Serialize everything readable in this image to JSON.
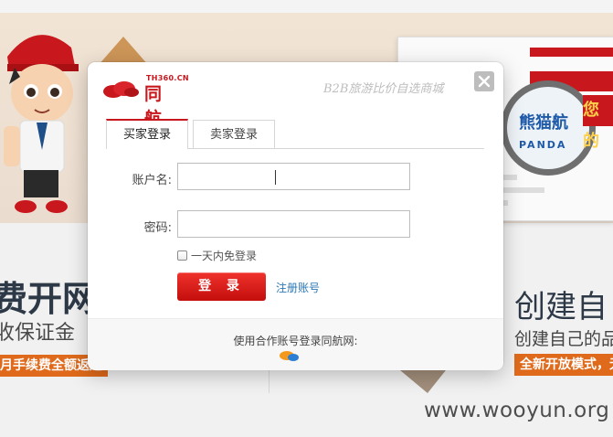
{
  "background": {
    "promo_left_title": "费开网",
    "promo_left_subtitle": "收保证金",
    "promo_left_bar": "月手续费全额返还",
    "promo_right_title": "创建自",
    "promo_right_subtitle": "创建自己的品",
    "promo_right_bar": "全新开放模式，无",
    "magnifier_brand": "熊猫航",
    "magnifier_brand_sub": "PANDA",
    "magnifier_red": "您的",
    "watermark": "www.wooyun.org"
  },
  "dialog": {
    "logo_domain": "TH360.CN",
    "logo_name": "同航",
    "slogan": "B2B旅游比价自选商城",
    "close_icon": "close-icon",
    "tabs": [
      {
        "label": "买家登录",
        "active": true
      },
      {
        "label": "卖家登录",
        "active": false
      }
    ],
    "account_label": "账户名:",
    "account_value": "",
    "password_label": "密码:",
    "password_value": "",
    "remember_label": "一天内免登录",
    "login_button": "登 录",
    "register_link": "注册账号",
    "partner_text": "使用合作账号登录同航网:",
    "partner_icon": "qq-icon"
  },
  "colors": {
    "brand_red": "#c8171d",
    "link_blue": "#2b78b6",
    "promo_orange": "#df6a1b"
  }
}
